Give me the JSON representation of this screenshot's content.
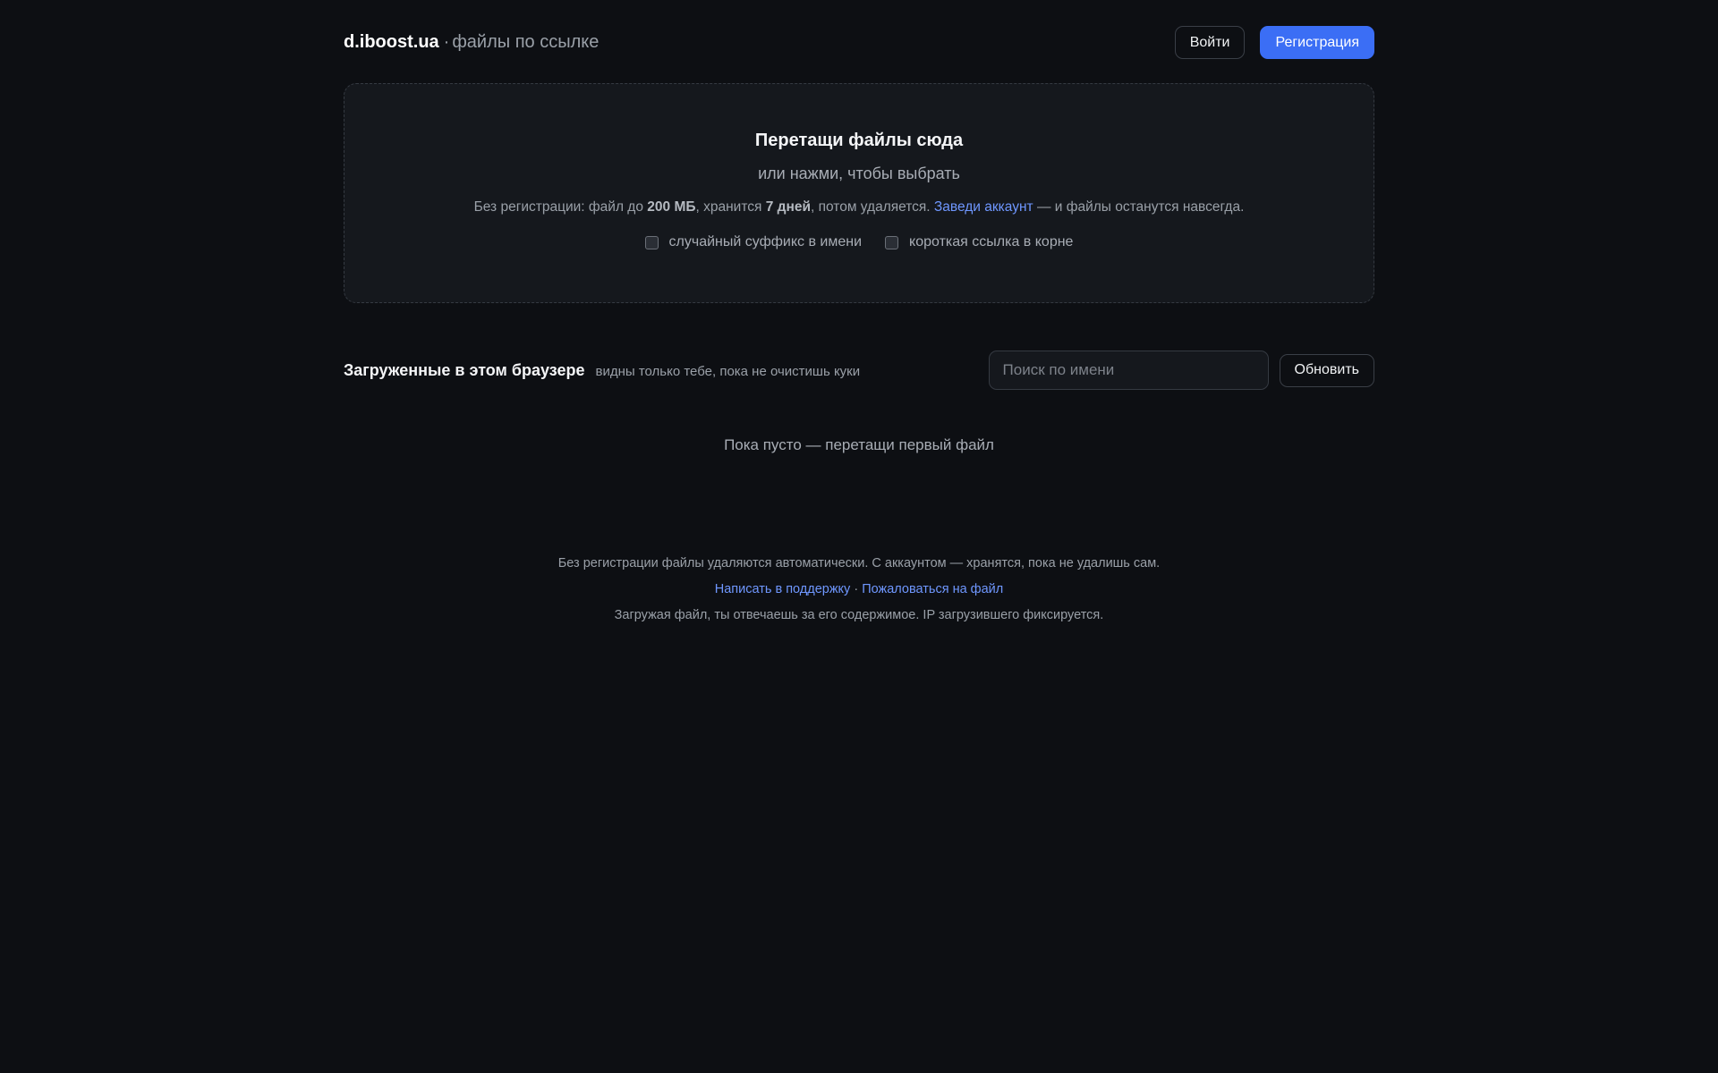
{
  "header": {
    "brand_name": "d.iboost.ua",
    "brand_separator": "·",
    "brand_tagline": "файлы по ссылке",
    "login_label": "Войти",
    "register_label": "Регистрация"
  },
  "dropzone": {
    "title": "Перетащи файлы сюда",
    "subtitle": "или нажми, чтобы выбрать",
    "note_prefix": "Без регистрации: файл до ",
    "note_size": "200 МБ",
    "note_mid": ", хранится ",
    "note_days": "7 дней",
    "note_after": ", потом удаляется. ",
    "note_link": "Заведи аккаунт",
    "note_suffix": " — и файлы останутся навсегда.",
    "options": [
      {
        "label": "случайный суффикс в имени",
        "checked": false
      },
      {
        "label": "короткая ссылка в корне",
        "checked": false
      }
    ]
  },
  "uploads": {
    "title": "Загруженные в этом браузере",
    "subtitle": "видны только тебе, пока не очистишь куки",
    "search_placeholder": "Поиск по имени",
    "refresh_label": "Обновить",
    "empty_text": "Пока пусто — перетащи первый файл"
  },
  "footer": {
    "line1": "Без регистрации файлы удаляются автоматически. С аккаунтом — хранятся, пока не удалишь сам.",
    "support_link": "Написать в поддержку",
    "links_separator": " · ",
    "report_link": "Пожаловаться на файл",
    "line3": "Загружая файл, ты отвечаешь за его содержимое. IP загрузившего фиксируется."
  },
  "colors": {
    "background": "#0d0f13",
    "panel": "#15181d",
    "accent": "#3b6ef5",
    "link": "#6f97ff"
  }
}
